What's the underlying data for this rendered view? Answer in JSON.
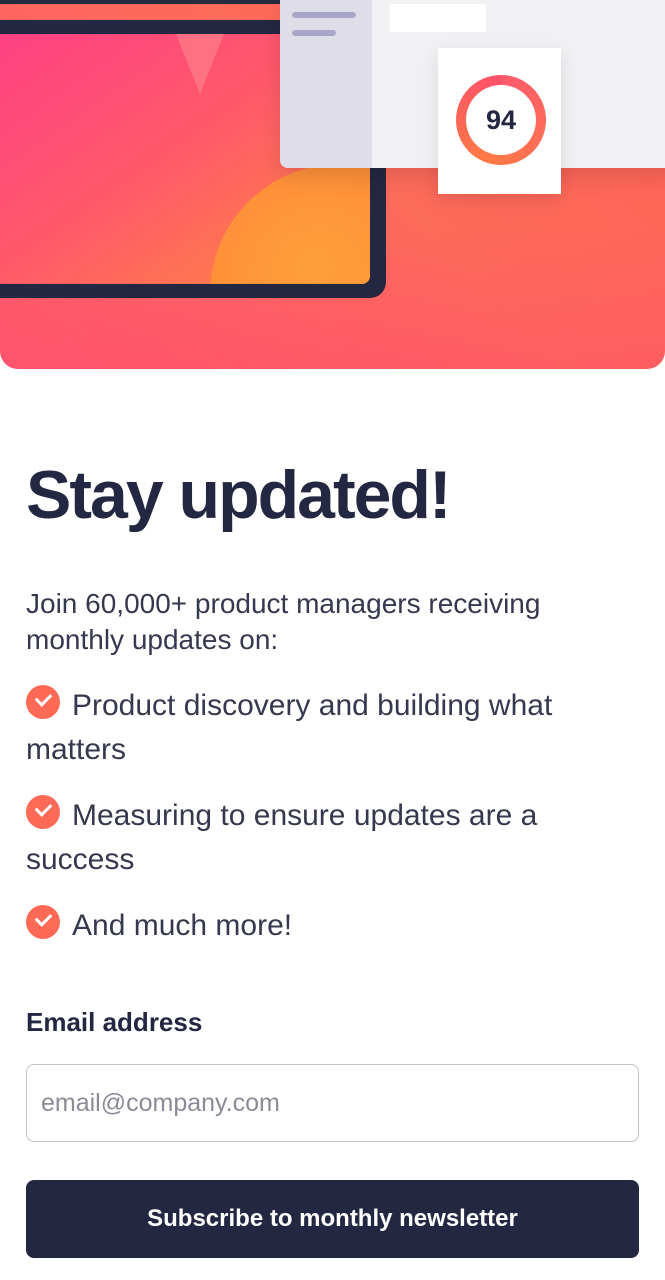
{
  "hero": {
    "score_value": "94"
  },
  "signup": {
    "title": "Stay updated!",
    "intro": "Join 60,000+ product managers receiving monthly updates on:",
    "features": [
      "Product discovery and building what matters",
      "Measuring to ensure updates are a success",
      "And much more!"
    ],
    "email_label": "Email address",
    "email_placeholder": "email@company.com",
    "email_value": "",
    "submit_label": "Subscribe to monthly newsletter"
  },
  "colors": {
    "accent": "#ff6257",
    "dark_navy": "#242742",
    "text": "#36384e"
  },
  "icons": {
    "feature_marker": "check-circle-icon"
  }
}
